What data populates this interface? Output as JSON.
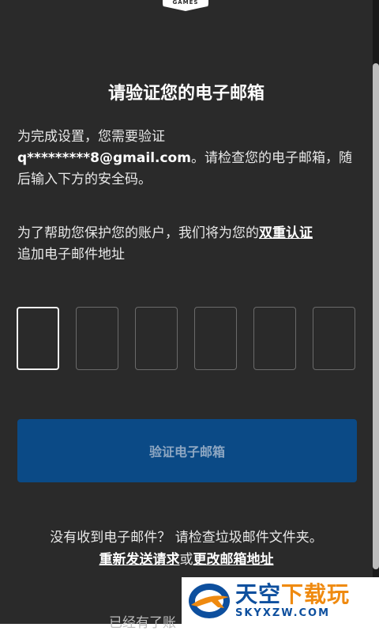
{
  "logo": {
    "text": "GAMES"
  },
  "title": "请验证您的电子邮箱",
  "intro": {
    "prefix": "为完成设置，您需要验证",
    "email": "q*********8@gmail.com",
    "suffix": "。请检查您的电子邮箱，随后输入下方的安全码。"
  },
  "twofa": {
    "prefix": "为了帮助您保护您的账户，我们将为您的",
    "link": "双重认证",
    "suffix": "追加电子邮件地址"
  },
  "code": {
    "length": 6,
    "active_index": 0
  },
  "verify_button": "验证电子邮箱",
  "footer": {
    "no_email": "没有收到电子邮件？ 请检查垃圾邮件文件夹。",
    "resend": "重新发送请求",
    "or": "或",
    "change": "更改邮箱地址",
    "already": "已经有了账"
  },
  "watermark": {
    "cn_blue": "天空",
    "cn_orange": "下载玩",
    "url": "SKYXZW.COM",
    "colors": {
      "blue": "#0d4f9e",
      "orange": "#ef8a10"
    }
  }
}
